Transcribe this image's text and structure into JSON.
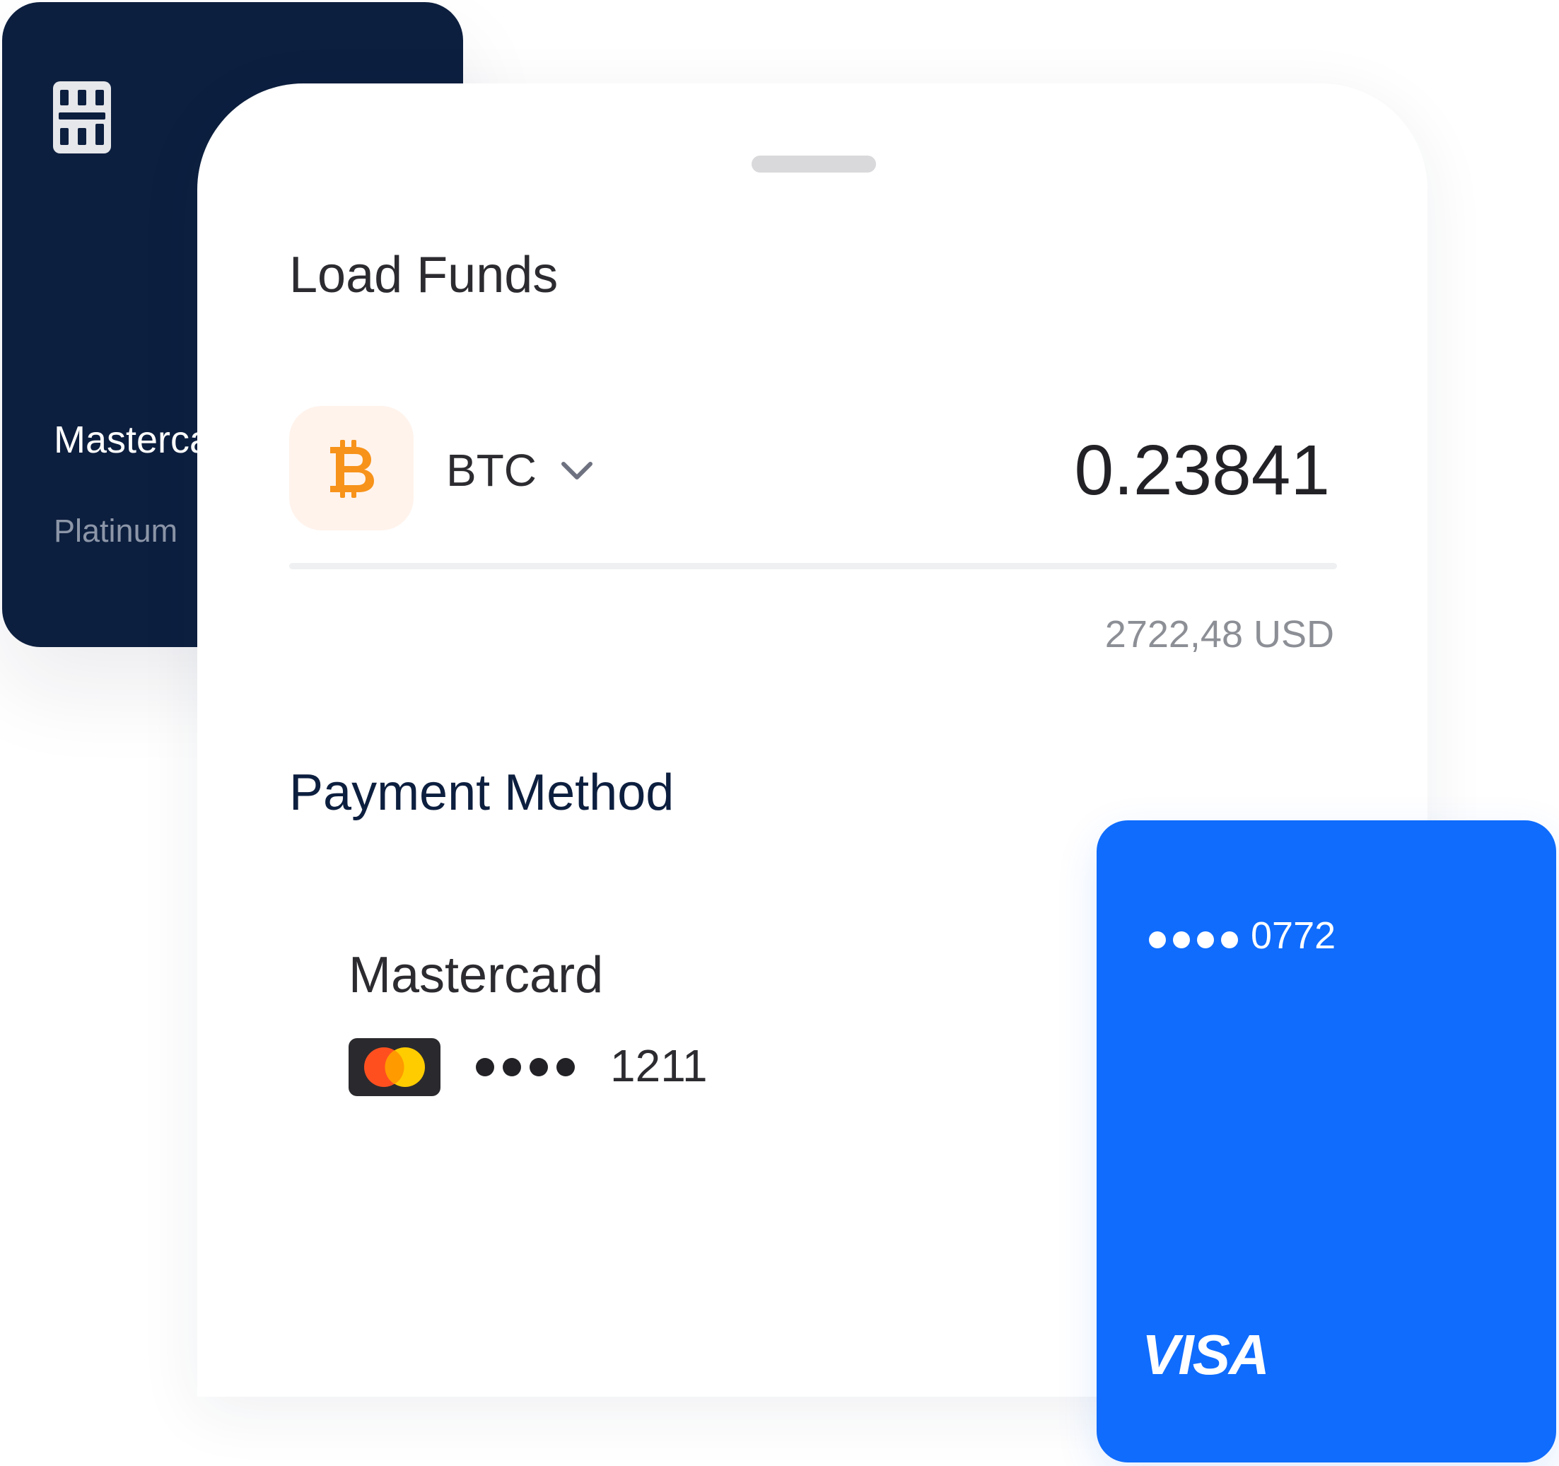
{
  "back_card": {
    "title": "Mastercard",
    "tier": "Platinum",
    "icon": "card-chip-icon",
    "color": "#0d1f3f"
  },
  "load_funds": {
    "title": "Load Funds",
    "currency": {
      "icon": "bitcoin-icon",
      "code": "BTC",
      "dropdown_icon": "chevron-down-icon"
    },
    "amount": "0.23841",
    "fiat_equivalent": "2722,48 USD"
  },
  "payment_method": {
    "title": "Payment Method",
    "selected": {
      "name": "Mastercard",
      "logo": "mastercard-logo-icon",
      "masked": "••••",
      "last4": "1211"
    }
  },
  "visa_card": {
    "masked": "••••",
    "last4": "0772",
    "brand": "VISA",
    "color": "#0f6cfd"
  },
  "colors": {
    "accent": "#0f6cfd",
    "navy": "#0d1f3f",
    "bitcoin": "#f7931a",
    "muted": "#8d8f96"
  }
}
